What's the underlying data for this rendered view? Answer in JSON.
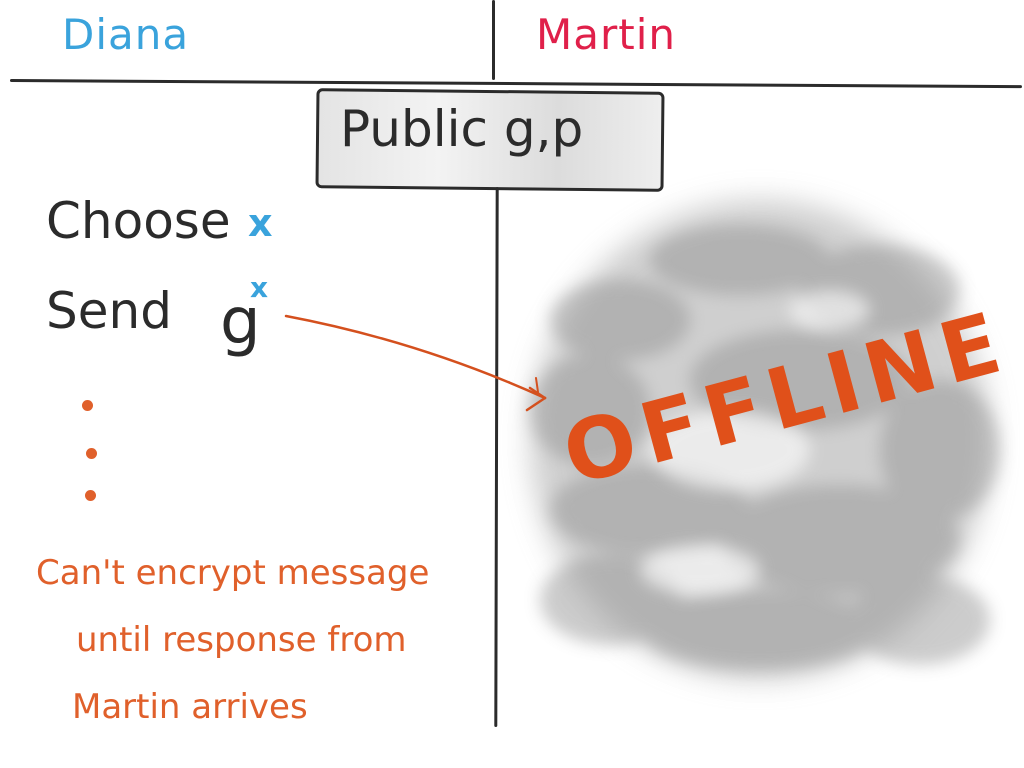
{
  "parties": {
    "left": "Diana",
    "right": "Martin"
  },
  "public_params": {
    "label": "Public g,p"
  },
  "steps": {
    "choose": {
      "label": "Choose",
      "variable": "x"
    },
    "send": {
      "label": "Send",
      "base": "g",
      "exponent": "x"
    }
  },
  "note": {
    "lines": [
      "Can't encrypt message",
      "until response from",
      "Martin arrives"
    ]
  },
  "status": {
    "label": "OFFLINE"
  },
  "colors": {
    "diana": "#3aa3dc",
    "martin": "#e0204a",
    "annotation": "#e0602b",
    "ink": "#2b2b2b",
    "cloud": "#9a9a9a"
  },
  "icons": {
    "arrow": "arrow-right-icon",
    "ellipsis": "vertical-ellipsis-icon",
    "cloud": "offline-cloud-icon"
  }
}
